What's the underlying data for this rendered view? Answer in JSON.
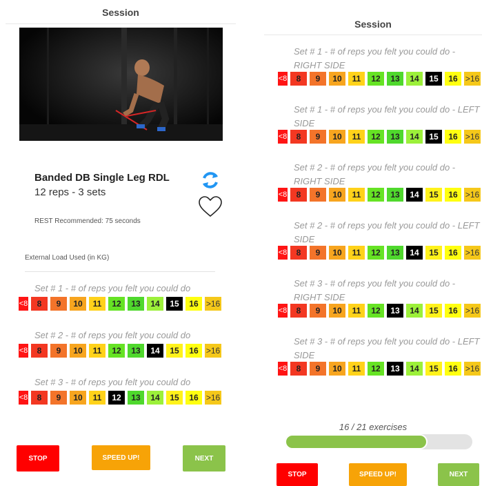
{
  "colors": {
    "lt8": "#ff1414",
    "v8": "#f33822",
    "v9": "#f3742a",
    "v10": "#f7a51f",
    "v11": "#ffd21a",
    "v12": "#66e324",
    "v13": "#4fd82d",
    "v14": "#9cf03a",
    "v15": "#fff21b",
    "v16": "#ffff10",
    "gt16": "#f5c81a",
    "selected": "#000000",
    "stop": "#ff0000",
    "speed": "#f7a307",
    "next": "#8bc34a"
  },
  "scale": [
    {
      "label": "<8",
      "key": "lt8"
    },
    {
      "label": "8",
      "key": "v8"
    },
    {
      "label": "9",
      "key": "v9"
    },
    {
      "label": "10",
      "key": "v10"
    },
    {
      "label": "11",
      "key": "v11"
    },
    {
      "label": "12",
      "key": "v12"
    },
    {
      "label": "13",
      "key": "v13"
    },
    {
      "label": "14",
      "key": "v14"
    },
    {
      "label": "15",
      "key": "v15"
    },
    {
      "label": "16",
      "key": "v16"
    },
    {
      "label": ">16",
      "key": "gt16"
    }
  ],
  "left": {
    "title": "Session",
    "exercise_name": "Banded DB Single Leg RDL",
    "exercise_reps": "12 reps - 3 sets",
    "rest": "REST Recommended: 75 seconds",
    "load_label": "External Load Used (in KG)",
    "icons": [
      "sync-icon",
      "heart-icon"
    ],
    "sets": [
      {
        "label": "Set # 1 - # of reps you felt you could do",
        "selected": "15"
      },
      {
        "label": "Set # 2 - # of reps you felt you could do",
        "selected": "14"
      },
      {
        "label": "Set # 3 - # of reps you felt you could do",
        "selected": "12"
      }
    ],
    "buttons": {
      "stop": "STOP",
      "speed": "SPEED UP!",
      "next": "NEXT"
    }
  },
  "right": {
    "title": "Session",
    "sets": [
      {
        "label": "Set # 1 - # of reps you felt you could do - RIGHT SIDE",
        "selected": "15"
      },
      {
        "label": "Set # 1 - # of reps you felt you could do - LEFT SIDE",
        "selected": "15"
      },
      {
        "label": "Set # 2 - # of reps you felt you could do - RIGHT SIDE",
        "selected": "14"
      },
      {
        "label": "Set # 2 - # of reps you felt you could do - LEFT SIDE",
        "selected": "14"
      },
      {
        "label": "Set # 3 - # of reps you felt you could do - RIGHT SIDE",
        "selected": "13"
      },
      {
        "label": "Set # 3 - # of reps you felt you could do - LEFT SIDE",
        "selected": "13"
      }
    ],
    "progress": {
      "label": "16 / 21 exercises",
      "fraction": 0.762
    },
    "buttons": {
      "stop": "STOP",
      "speed": "SPEED UP!",
      "next": "NEXT"
    }
  }
}
